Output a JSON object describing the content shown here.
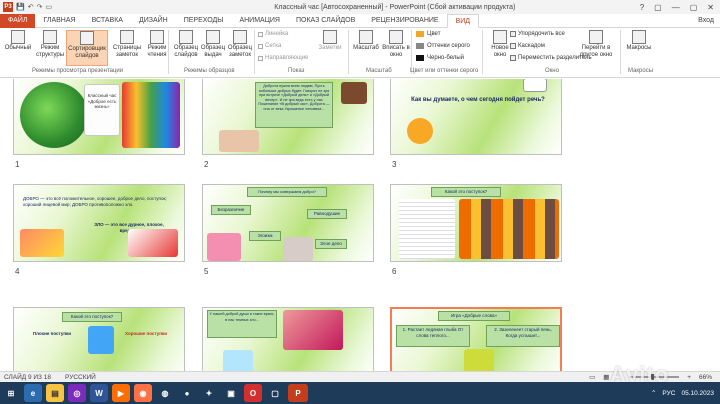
{
  "window": {
    "title": "Классный час [Автосохраненный] - PowerPoint (Сбой активации продукта)",
    "app_badge": "P3",
    "controls": [
      "?",
      "▢",
      "—",
      "▢",
      "✕"
    ]
  },
  "tabs": [
    {
      "label": "ФАЙЛ"
    },
    {
      "label": "ГЛАВНАЯ"
    },
    {
      "label": "ВСТАВКА"
    },
    {
      "label": "ДИЗАЙН"
    },
    {
      "label": "ПЕРЕХОДЫ"
    },
    {
      "label": "АНИМАЦИЯ"
    },
    {
      "label": "ПОКАЗ СЛАЙДОВ"
    },
    {
      "label": "РЕЦЕНЗИРОВАНИЕ"
    },
    {
      "label": "ВИД"
    }
  ],
  "user": "Вход",
  "ribbon": {
    "buttons": [
      {
        "label": "Обычный"
      },
      {
        "label": "Режим структуры"
      },
      {
        "label": "Сортировщик слайдов"
      },
      {
        "label": "Страницы заметок"
      },
      {
        "label": "Режим чтения"
      },
      {
        "label": "Образец слайдов"
      },
      {
        "label": "Образец выдач"
      },
      {
        "label": "Образец заметок"
      }
    ],
    "checkboxes": [
      {
        "label": "Линейка"
      },
      {
        "label": "Сетка"
      },
      {
        "label": "Направляющие"
      }
    ],
    "notes_label": "Заметки",
    "zoom_labels": [
      {
        "label": "Масштаб"
      },
      {
        "label": "Вписать в окно"
      }
    ],
    "colors": [
      {
        "label": "Цвет",
        "swatch": "#f5a623"
      },
      {
        "label": "Оттенки серого",
        "swatch": "#888888"
      },
      {
        "label": "Черно-белый",
        "swatch": "#111111"
      }
    ],
    "window_buttons": [
      {
        "label": "Новое окно"
      },
      {
        "label": "Упорядочить все"
      },
      {
        "label": "Каскадом"
      },
      {
        "label": "Переместить разделитель"
      },
      {
        "label": "Перейти в другое окно"
      },
      {
        "label": "Макросы"
      }
    ],
    "groups": [
      {
        "label": "Режимы просмотра презентации"
      },
      {
        "label": "Режимы образцов"
      },
      {
        "label": "Показ"
      },
      {
        "label": "Масштаб"
      },
      {
        "label": "Цвет или оттенки серого"
      },
      {
        "label": "Окно"
      },
      {
        "label": "Макросы"
      }
    ]
  },
  "slides": [
    {
      "num": "1",
      "text": "Классный час «Доброе есть жизнь»"
    },
    {
      "num": "2",
      "text": "Доброта нужна всем людям, Пусть побольше добрых будет. Говорят не зря при встрече «Добрый день» и «Добрый вечер». И не зря ведь есть у нас Пожелание «В добрый час». Доброта — она от века Украшенье человека..."
    },
    {
      "num": "3",
      "text": "Как вы думаете, о чем сегодня пойдет речь?"
    },
    {
      "num": "4",
      "text": "ДОБРО — это всё положительное, хорошее, доброе дело, поступок; хороший лицевой мир; ДОБРО противоположно зло.",
      "text2": "ЗЛО — это все дурное, плохое, вредное"
    },
    {
      "num": "5",
      "text": "Почему мы совершаем добро?",
      "labels": [
        "Безразличие",
        "Равнодушие",
        "Эгоизм",
        "Злое дело"
      ]
    },
    {
      "num": "6",
      "text": "Какой это поступок?"
    },
    {
      "num": "7",
      "text": "Какой это поступок?",
      "text2": "Плохие поступки",
      "text3": "Хорошие поступки"
    },
    {
      "num": "8",
      "text": "У нашей доброй души и такие враги, в нас темных зло..."
    },
    {
      "num": "9",
      "text": "Игра «Добрые слова»",
      "text2": "1. Растает ледяная глыба От слова теплого...",
      "text3": "2. Зазеленеет старый пень, Когда услышит..."
    }
  ],
  "status": {
    "slide": "СЛАЙД 9 ИЗ 18",
    "lang": "РУССКИЙ",
    "zoom": "66%"
  },
  "taskbar": {
    "lang": "РУС",
    "time": "",
    "date": "05.10.2023"
  },
  "watermark": "Avito"
}
